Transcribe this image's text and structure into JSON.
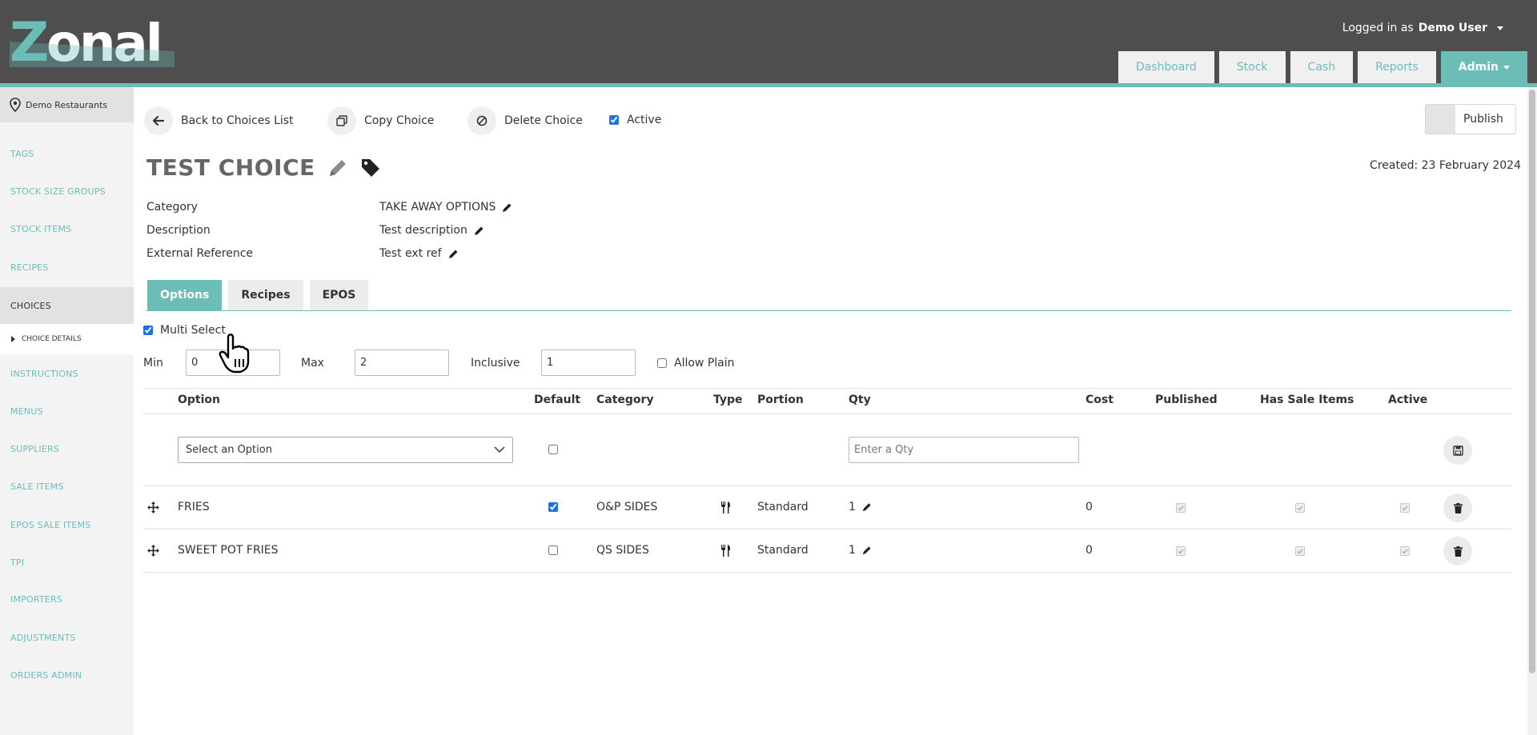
{
  "header": {
    "logo_text": "Zonal",
    "logged_in_prefix": "Logged in as",
    "user_name": "Demo User",
    "nav": [
      {
        "label": "Dashboard"
      },
      {
        "label": "Stock"
      },
      {
        "label": "Cash"
      },
      {
        "label": "Reports"
      },
      {
        "label": "Admin"
      }
    ],
    "active_nav": "Admin"
  },
  "sidebar": {
    "site": "Demo Restaurants",
    "items": [
      {
        "label": "TAGS"
      },
      {
        "label": "STOCK SIZE GROUPS"
      },
      {
        "label": "STOCK ITEMS"
      },
      {
        "label": "RECIPES"
      },
      {
        "label": "CHOICES"
      },
      {
        "label": "CHOICE DETAILS"
      },
      {
        "label": "INSTRUCTIONS"
      },
      {
        "label": "MENUS"
      },
      {
        "label": "SUPPLIERS"
      },
      {
        "label": "SALE ITEMS"
      },
      {
        "label": "EPOS SALE ITEMS"
      },
      {
        "label": "TPI"
      },
      {
        "label": "IMPORTERS"
      },
      {
        "label": "ADJUSTMENTS"
      },
      {
        "label": "ORDERS ADMIN"
      }
    ]
  },
  "toolbar": {
    "back_label": "Back to Choices List",
    "copy_label": "Copy Choice",
    "delete_label": "Delete Choice",
    "active_label": "Active",
    "active_checked": true,
    "publish_label": "Publish"
  },
  "choice": {
    "title": "TEST CHOICE",
    "created": "Created: 23 February 2024",
    "fields": [
      {
        "key": "Category",
        "value": "TAKE AWAY OPTIONS"
      },
      {
        "key": "Description",
        "value": "Test description"
      },
      {
        "key": "External Reference",
        "value": "Test ext ref"
      }
    ]
  },
  "tabs": [
    {
      "label": "Options"
    },
    {
      "label": "Recipes"
    },
    {
      "label": "EPOS"
    }
  ],
  "active_tab": "Options",
  "options": {
    "multi_select_label": "Multi Select",
    "multi_select_checked": true,
    "min_label": "Min",
    "min_value": "0",
    "max_label": "Max",
    "max_value": "2",
    "inclusive_label": "Inclusive",
    "inclusive_value": "1",
    "allow_plain_label": "Allow Plain",
    "allow_plain_checked": false
  },
  "table": {
    "headers": {
      "option": "Option",
      "default": "Default",
      "category": "Category",
      "type": "Type",
      "portion": "Portion",
      "qty": "Qty",
      "cost": "Cost",
      "published": "Published",
      "has_sale_items": "Has Sale Items",
      "active": "Active"
    },
    "new_row": {
      "select_placeholder": "Select an Option",
      "qty_placeholder": "Enter a Qty"
    },
    "rows": [
      {
        "option": "FRIES",
        "default": true,
        "category": "O&P SIDES",
        "type_icon": "cutlery-icon",
        "portion": "Standard",
        "qty": "1",
        "cost": "0"
      },
      {
        "option": "SWEET POT FRIES",
        "default": false,
        "category": "QS SIDES",
        "type_icon": "cutlery-icon",
        "portion": "Standard",
        "qty": "1",
        "cost": "0"
      }
    ]
  },
  "colors": {
    "brand_teal": "#6cbcb8",
    "header_gray": "#4e4e4e",
    "sidebar_bg": "#f3f3f3"
  }
}
